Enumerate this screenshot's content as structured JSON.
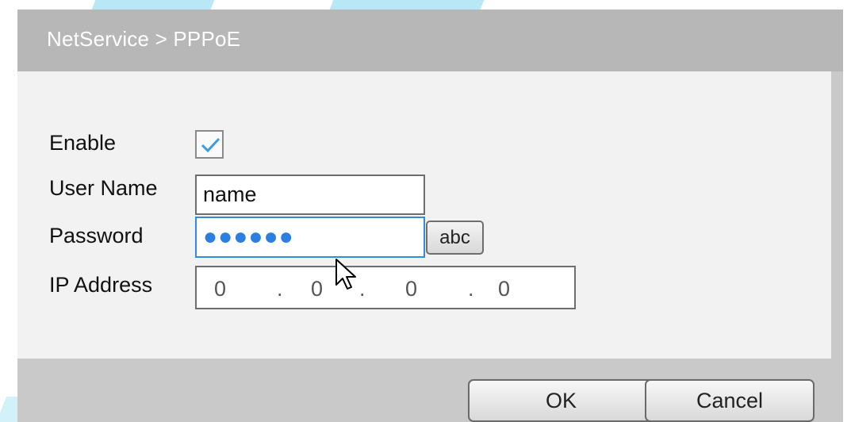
{
  "dialog": {
    "breadcrumb": "NetService > PPPoE"
  },
  "form": {
    "enable": {
      "label": "Enable",
      "checked": true
    },
    "user_name": {
      "label": "User Name",
      "value": "name"
    },
    "password": {
      "label": "Password",
      "masked_value": "●●●●●●",
      "toggle_label": "abc"
    },
    "ip_address": {
      "label": "IP Address",
      "octets": [
        "0",
        "0",
        "0",
        "0"
      ],
      "separator": "."
    }
  },
  "buttons": {
    "ok": "OK",
    "cancel": "Cancel"
  },
  "colors": {
    "title_bar": "#b7b7b7",
    "panel": "#f2f2f2",
    "focus_border": "#2f8edc",
    "checkmark": "#3a9be0"
  },
  "icons": {
    "checkbox": "checkmark-icon",
    "pointer": "mouse-cursor-icon"
  }
}
